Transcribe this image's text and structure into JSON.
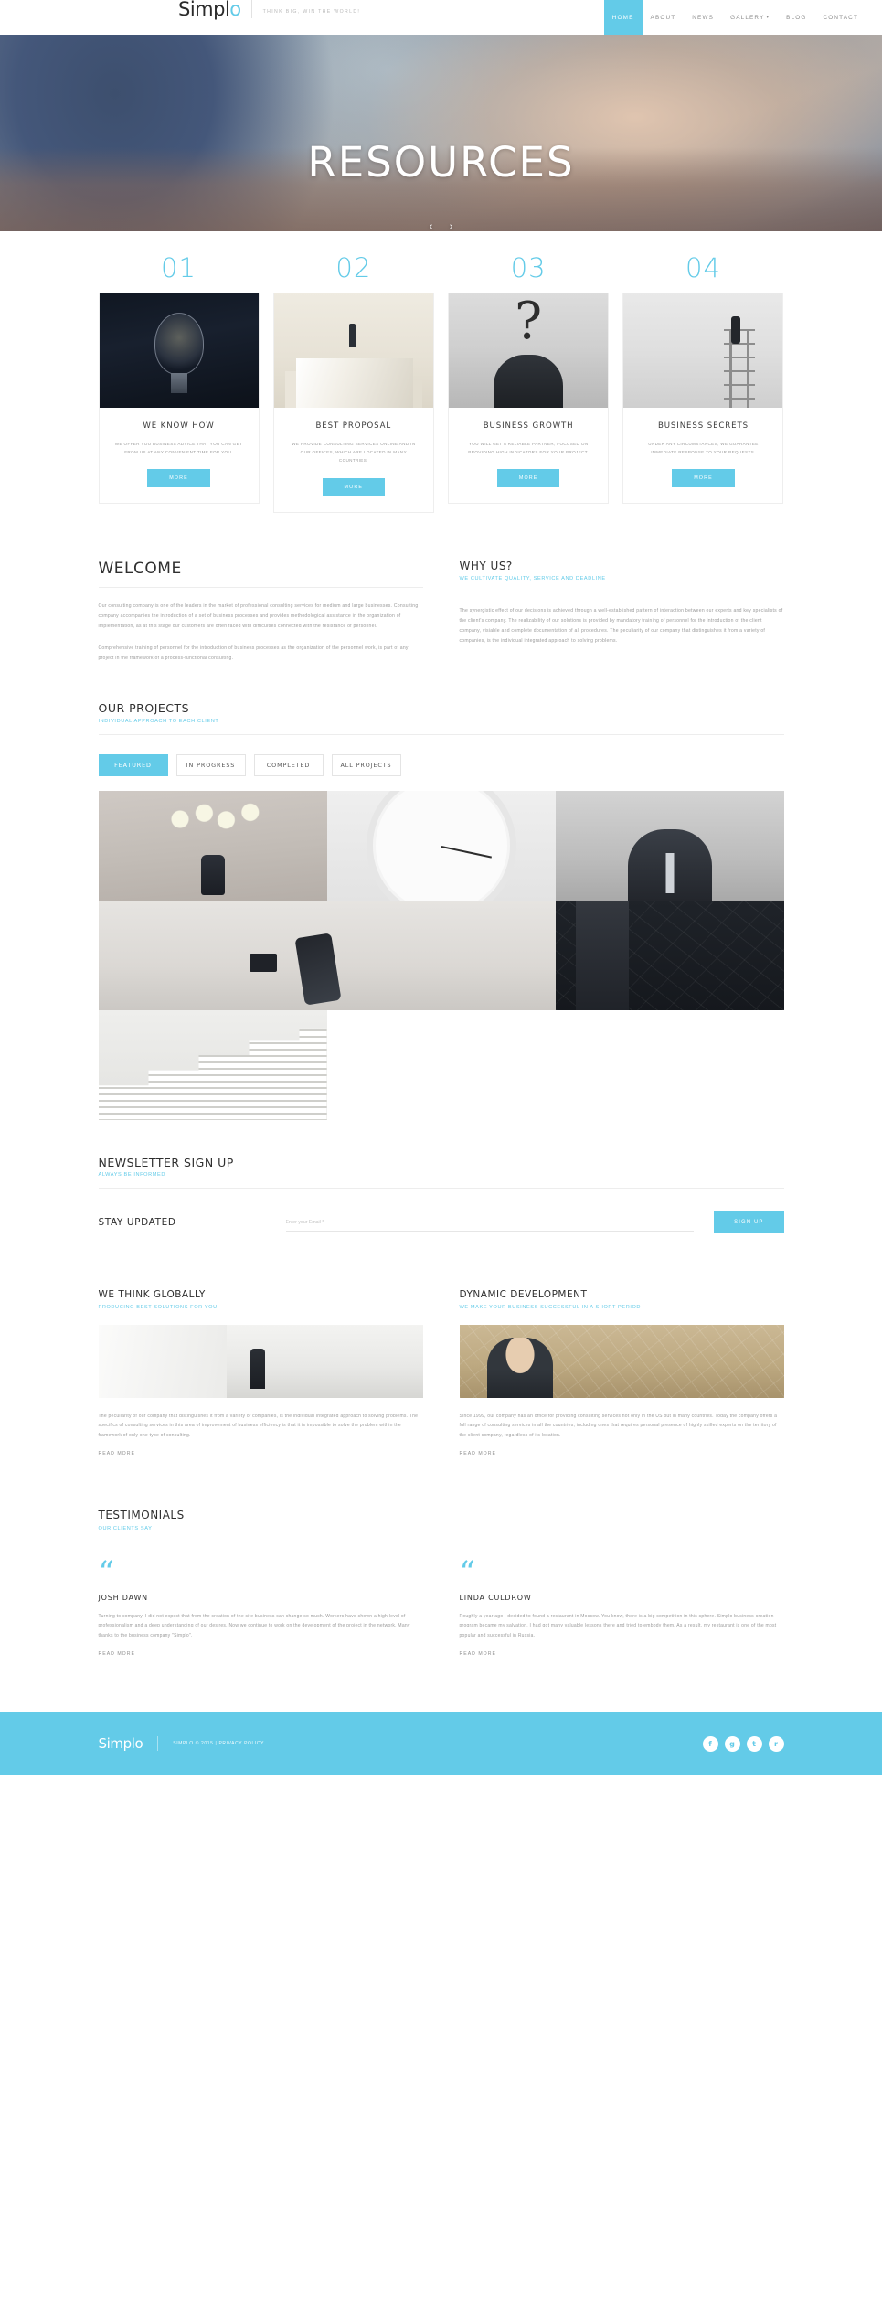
{
  "header": {
    "logo_main": "Simpl",
    "logo_accent": "o",
    "tagline": "THINK BIG, WIN THE WORLD!",
    "nav": [
      {
        "label": "HOME",
        "active": true
      },
      {
        "label": "ABOUT",
        "active": false
      },
      {
        "label": "NEWS",
        "active": false
      },
      {
        "label": "GALLERY",
        "active": false,
        "caret": "▾"
      },
      {
        "label": "BLOG",
        "active": false
      },
      {
        "label": "CONTACT",
        "active": false
      }
    ]
  },
  "hero": {
    "title": "RESOURCES",
    "prev_arrow": "‹",
    "next_arrow": "›"
  },
  "services": [
    {
      "number": "01",
      "title": "WE KNOW HOW",
      "desc": "WE OFFER YOU BUSINESS ADVICE THAT YOU CAN GET FROM US AT ANY CONVENIENT TIME FOR YOU.",
      "more": "MORE"
    },
    {
      "number": "02",
      "title": "BEST PROPOSAL",
      "desc": "WE PROVIDE CONSULTING SERVICES ONLINE AND IN OUR OFFICES, WHICH ARE LOCATED IN MANY COUNTRIES.",
      "more": "MORE"
    },
    {
      "number": "03",
      "title": "BUSINESS GROWTH",
      "desc": "YOU WILL GET A RELIABLE PARTNER, FOCUSED ON PROVIDING HIGH INDICATORS FOR YOUR PROJECT.",
      "more": "MORE"
    },
    {
      "number": "04",
      "title": "BUSINESS SECRETS",
      "desc": "UNDER ANY CIRCUMSTANCES, WE GUARANTEE IMMEDIATE RESPONSE TO YOUR REQUESTS.",
      "more": "MORE"
    }
  ],
  "welcome": {
    "title": "WELCOME",
    "p1": "Our consulting company is one of the leaders in the market of professional consulting services for medium and large businesses. Consulting company accompanies the introduction of a set of business processes and provides methodological assistance in the organization of implementation, as at this stage our customers are often faced with difficulties connected with the resistance of personnel.",
    "p2": "Comprehensive training of personnel for the introduction of business processes as the organization of the personnel work, is part of any project in the framework of a process-functional consulting."
  },
  "whyus": {
    "title": "WHY US?",
    "subtitle": "WE CULTIVATE QUALITY, SERVICE AND DEADLINE",
    "p1": "The synergistic effect of our decisions is achieved through a well-established pattern of interaction between our experts and key specialists of the client's company. The realizability of our solutions is provided by mandatory training of personnel for the introduction of the client company, visiable and complete documentation of all procedures. The peculiarity of our company that distinguishes it from a variety of companies, is the individual integrated approach to solving problems."
  },
  "projects": {
    "title": "OUR PROJECTS",
    "subtitle": "INDIVIDUAL APPROACH TO EACH CLIENT",
    "filters": [
      {
        "label": "FEATURED",
        "active": true
      },
      {
        "label": "IN PROGRESS",
        "active": false
      },
      {
        "label": "COMPLETED",
        "active": false
      },
      {
        "label": "ALL PROJECTS",
        "active": false
      }
    ]
  },
  "newsletter": {
    "title": "NEWSLETTER SIGN UP",
    "subtitle": "ALWAYS BE INFORMED",
    "stay_updated": "STAY UPDATED",
    "email_placeholder": "Enter your Email *",
    "email_value": "",
    "button": "SIGN UP"
  },
  "features": [
    {
      "title": "WE THINK GLOBALLY",
      "subtitle": "PRODUCING BEST SOLUTIONS FOR YOU",
      "text": "The peculiarity of our company that distinguishes it from a variety of companies, is the individual integrated approach to solving problems. The specifics of consulting services in this area of improvement of business efficiency is that it is impossible to solve the problem within the framework of only one type of consulting.",
      "readmore": "READ MORE"
    },
    {
      "title": "DYNAMIC DEVELOPMENT",
      "subtitle": "WE MAKE YOUR BUSINESS SUCCESSFUL IN A SHORT PERIOD",
      "text": "Since 1999, our company has an office for providing consulting services not only in the US but in many countries. Today the company offers a full range of consulting services in all the countries, including ones that requires personal presence of highly skilled experts on the territory of the client company, regardless of its location.",
      "readmore": "READ MORE"
    }
  ],
  "testimonials": {
    "title": "TESTIMONIALS",
    "subtitle": "OUR CLIENTS SAY",
    "items": [
      {
        "quote_icon": "“",
        "name": "JOSH DAWN",
        "text": "Turning to company, I did not expect that from the creation of the site business can change so much. Workers have shown a high level of professionalism and a deep understanding of our desires. Now we continue to work on the development of the project in the network. Many thanks to the business company \"Simplo\".",
        "readmore": "READ MORE"
      },
      {
        "quote_icon": "“",
        "name": "LINDA CULDROW",
        "text": "Roughly a year ago I decided to found a restaurant in Moscow. You know, there is a big competition in this sphere. Simplo business-creation program became my salvation. I had got many valuable lessons there and tried to embody them. As a result, my restaurant is one of the most popular and successful in Russia.",
        "readmore": "READ MORE"
      }
    ]
  },
  "footer": {
    "logo": "Simplo",
    "copyright": "SIMPLO © 2015 | PRIVACY POLICY",
    "socials": [
      {
        "name": "facebook-icon",
        "glyph": "f"
      },
      {
        "name": "google-plus-icon",
        "glyph": "g"
      },
      {
        "name": "twitter-icon",
        "glyph": "t"
      },
      {
        "name": "rss-icon",
        "glyph": "r"
      }
    ]
  }
}
